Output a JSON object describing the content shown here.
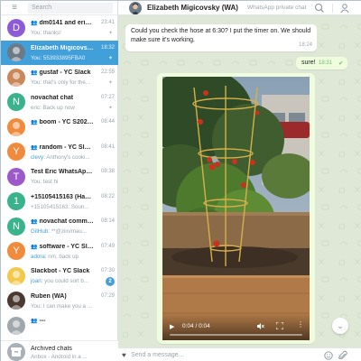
{
  "sidebar": {
    "search_placeholder": "Search",
    "chats": [
      {
        "name": "dm0141 and eric...",
        "group": true,
        "time": "23:41",
        "preview": "You: thanks!",
        "sender": "",
        "pinned": true,
        "avatar_letter": "D",
        "avatar_color": "#8e5bd6"
      },
      {
        "name": "Elizabeth Migicovsky...",
        "group": false,
        "time": "18:32",
        "preview": "You: 553933895FBA0",
        "sender": "",
        "pinned": true,
        "active": true,
        "avatar_letter": "",
        "avatar_color": "#6b7a86"
      },
      {
        "name": "gustaf - YC Slack",
        "group": true,
        "time": "22:55",
        "preview": "You: that's only for the...",
        "sender": "",
        "pinned": true,
        "avatar_letter": "",
        "avatar_color": "#c9875a"
      },
      {
        "name": "novachat chat",
        "group": false,
        "time": "07:27",
        "preview": "eric: Back up now",
        "sender": "",
        "pinned": true,
        "avatar_letter": "N",
        "avatar_color": "#3bb38a"
      },
      {
        "name": "boom - YC S2020 ...",
        "group": true,
        "time": "08:44",
        "preview": "",
        "sender": "",
        "pinned": false,
        "avatar_letter": "",
        "avatar_color": "#f08a3c"
      },
      {
        "name": "random - YC Slack",
        "group": true,
        "time": "08:41",
        "preview": "Anthony's cooki...",
        "sender": "clevy:",
        "pinned": false,
        "avatar_letter": "Y",
        "avatar_color": "#f08a3c"
      },
      {
        "name": "Test Eric WhatsApp (...",
        "group": false,
        "time": "08:38",
        "preview": "You: test hi",
        "sender": "",
        "pinned": false,
        "avatar_letter": "T",
        "avatar_color": "#9b59c9"
      },
      {
        "name": "+15105415163 (Hang...",
        "group": false,
        "time": "08:22",
        "preview": "+15105415163: Soun...",
        "sender": "",
        "pinned": false,
        "avatar_letter": "1",
        "avatar_color": "#3bb38a"
      },
      {
        "name": "novachat commits",
        "group": true,
        "time": "08:14",
        "preview": "**@ziin/mau...",
        "sender": "GitHub:",
        "pinned": false,
        "avatar_letter": "N",
        "avatar_color": "#3bb38a"
      },
      {
        "name": "software - YC Slack",
        "group": true,
        "time": "07:49",
        "preview": "nm, back up",
        "sender": "adora:",
        "pinned": false,
        "avatar_letter": "Y",
        "avatar_color": "#f08a3c"
      },
      {
        "name": "Slackbot - YC Slack",
        "group": false,
        "time": "07:30",
        "preview": "you could sort b...",
        "sender": "joan:",
        "pinned": false,
        "badge": "2",
        "avatar_letter": "",
        "avatar_color": "#f2c94c"
      },
      {
        "name": "Ruben (WA)",
        "group": false,
        "time": "07:29",
        "preview": "You: I can make you a ...",
        "sender": "",
        "pinned": false,
        "avatar_letter": "",
        "avatar_color": "#4a3a32"
      },
      {
        "name": "---",
        "group": true,
        "time": "",
        "preview": "",
        "sender": "",
        "pinned": false,
        "avatar_letter": "",
        "avatar_color": "#a0a8ae"
      }
    ],
    "archived": {
      "title": "Archived chats",
      "preview": "Anbox - Android in a ..."
    }
  },
  "header": {
    "name": "Elizabeth Migicovsky (WA)",
    "status": "WhatsApp private chat"
  },
  "messages": {
    "incoming": {
      "line1": "Could you check the hose at 6:30? I put the timer on. We should",
      "line2": "make sure it's working.",
      "time": "18:24"
    },
    "outgoing": {
      "text": "sure!",
      "time": "18:31",
      "check": "✔"
    }
  },
  "video": {
    "play": "▶",
    "time": "0:04 / 0:04",
    "more": "⋮",
    "progress": 1.0
  },
  "composer": {
    "heart": "♥",
    "placeholder": "Send a message..."
  },
  "icons": {
    "hamburger": "≡",
    "scroll_down": "⌄",
    "pin": "✦"
  },
  "colors": {
    "accent": "#419fd9",
    "chat_bg": "#dfe8d7",
    "outgoing_bubble": "#effdde"
  }
}
